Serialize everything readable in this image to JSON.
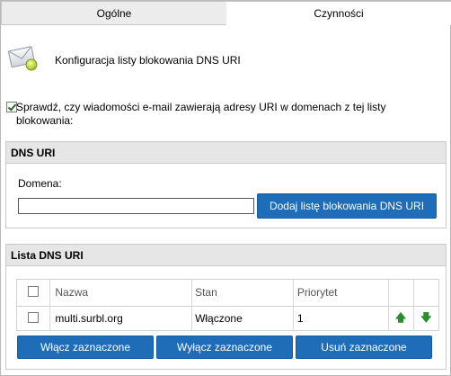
{
  "tabs": [
    {
      "label": "Ogólne",
      "active": false
    },
    {
      "label": "Czynności",
      "active": true
    }
  ],
  "header": {
    "icon": "envelope-config-icon",
    "title": "Konfiguracja listy blokowania DNS URI"
  },
  "check_uri": {
    "checked": true,
    "label": "Sprawdź, czy wiadomości e-mail zawierają adresy URI w domenach z tej listy blokowania:"
  },
  "dns_uri": {
    "heading": "DNS URI",
    "domain_label": "Domena:",
    "domain_value": "",
    "add_button": "Dodaj listę blokowania DNS URI"
  },
  "dns_list": {
    "heading": "Lista DNS URI",
    "columns": [
      "Nazwa",
      "Stan",
      "Priorytet"
    ],
    "rows": [
      {
        "name": "multi.surbl.org",
        "stan": "Włączone",
        "priorytet": "1"
      }
    ],
    "buttons": {
      "enable": "Włącz zaznaczone",
      "disable": "Wyłącz zaznaczone",
      "delete": "Usuń zaznaczone"
    }
  },
  "colors": {
    "button_bg": "#1f6cb8",
    "arrow": "#2e8b2e",
    "panel_head": "#e6e6e6"
  }
}
